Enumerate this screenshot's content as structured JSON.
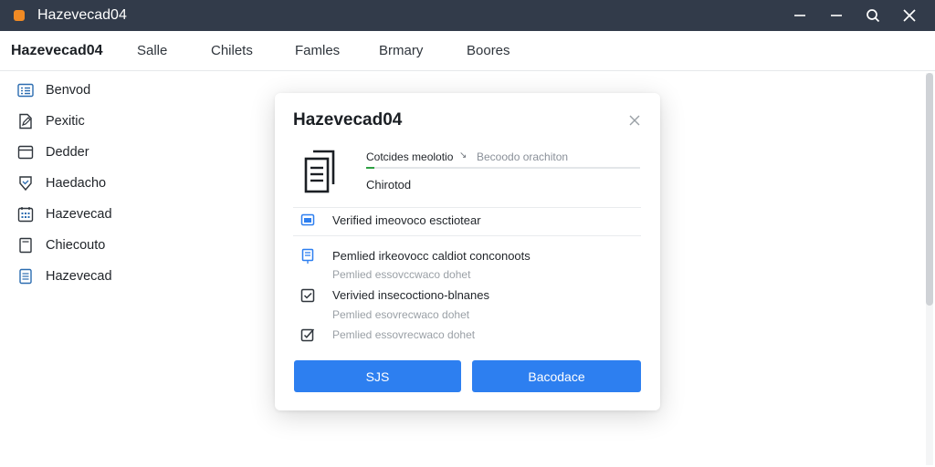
{
  "window": {
    "title": "Hazevecad04",
    "icons": {
      "app": "app-square-icon",
      "minimize": "minimize-icon",
      "maximize": "maximize-icon",
      "search": "search-icon",
      "close": "close-icon"
    }
  },
  "menubar": {
    "brand": "Hazevecad04",
    "items": [
      "Salle",
      "Chilets",
      "Famles",
      "Brmary",
      "Boores"
    ]
  },
  "sidebar": {
    "items": [
      {
        "label": "Benvod",
        "icon": "list-icon"
      },
      {
        "label": "Pexitic",
        "icon": "document-edit-icon"
      },
      {
        "label": "Dedder",
        "icon": "card-icon"
      },
      {
        "label": "Haedacho",
        "icon": "shield-icon"
      },
      {
        "label": "Hazevecad",
        "icon": "calendar-grid-icon"
      },
      {
        "label": "Chiecouto",
        "icon": "file-icon"
      },
      {
        "label": "Hazevecad",
        "icon": "notes-icon"
      }
    ]
  },
  "dialog": {
    "title": "Hazevecad04",
    "progress": {
      "label": "Cotcides meolotio",
      "arrow": "↘",
      "status": "Becoodo orachiton",
      "fraction": 0.03,
      "sublabel": "Chirotod"
    },
    "rows": [
      {
        "text": "Verified imeovoco esctiotear",
        "sub": "",
        "icon": "folder-blue-icon"
      },
      {
        "text": "Pemlied irkeovocc caldiot conconoots",
        "sub": "Pemlied essovccwaco dohet",
        "icon": "document-blue-icon"
      },
      {
        "text": "Verivied insecoctiono-blnanes",
        "sub": "Pemlied esovrecwaco dohet",
        "icon": "checkbox-icon"
      },
      {
        "text": "",
        "sub": "Pemlied essovrecwaco dohet",
        "icon": "checkbox-edit-icon"
      }
    ],
    "buttons": {
      "primary": "SJS",
      "secondary": "Bacodace"
    }
  },
  "colors": {
    "titlebar": "#323b4a",
    "app_icon": "#f08a24",
    "accent": "#2d7ff0",
    "progress": "#2ea043"
  }
}
